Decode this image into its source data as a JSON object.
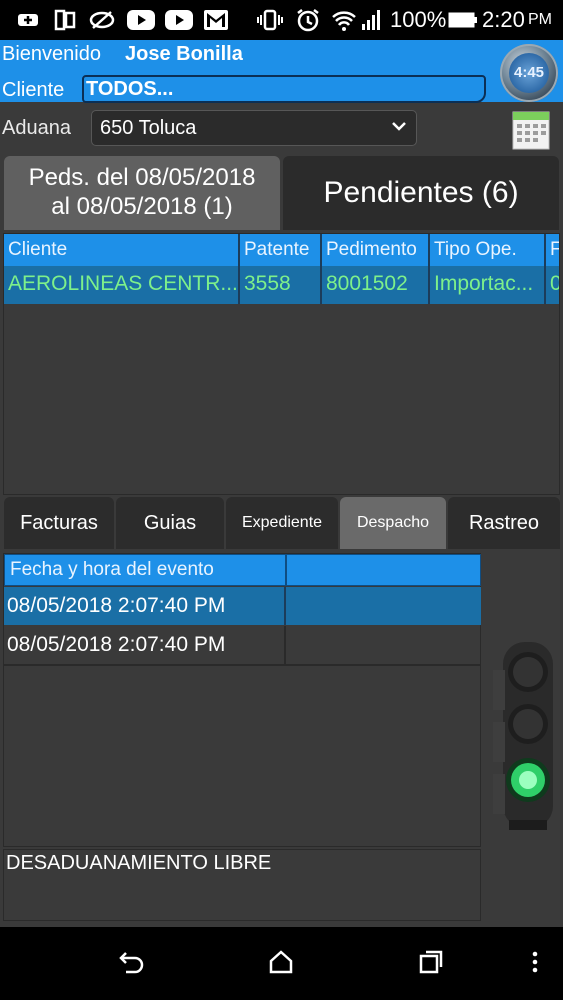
{
  "status_bar": {
    "battery": "100%",
    "time": "2:20",
    "ampm": "PM",
    "icons": [
      "add-box-icon",
      "dual-screen-icon",
      "eye-off-icon",
      "youtube-icon",
      "youtube-icon",
      "gmail-icon",
      "vibrate-icon",
      "alarm-icon",
      "wifi-icon",
      "signal-icon",
      "battery-icon"
    ]
  },
  "header": {
    "welcome_label": "Bienvenido",
    "user_name": "Jose Bonilla",
    "cliente_label": "Cliente",
    "cliente_value": "TODOS...",
    "clock_text": "4:45",
    "aduana_label": "Aduana",
    "aduana_value": "650 Toluca"
  },
  "top_tabs": {
    "left_line1": "Peds. del 08/05/2018",
    "left_line2": "al 08/05/2018 (1)",
    "right": "Pendientes (6)"
  },
  "grid": {
    "columns": [
      "Cliente",
      "Patente",
      "Pedimento",
      "Tipo Ope.",
      "F"
    ],
    "rows": [
      [
        "AEROLINEAS CENTR...",
        "3558",
        "8001502",
        "Importac...",
        "0"
      ]
    ]
  },
  "bottom_tabs": [
    "Facturas",
    "Guias",
    "Expediente",
    "Despacho",
    "Rastreo"
  ],
  "events": {
    "column": "Fecha y hora del evento",
    "rows": [
      "08/05/2018 2:07:40 PM",
      "08/05/2018 2:07:40 PM"
    ]
  },
  "status_text": "DESADUANAMIENTO LIBRE",
  "traffic_light": {
    "active": "green"
  },
  "colors": {
    "accent": "#1e90e8",
    "row_text": "#7ef08a",
    "background": "#3a3a3a"
  }
}
